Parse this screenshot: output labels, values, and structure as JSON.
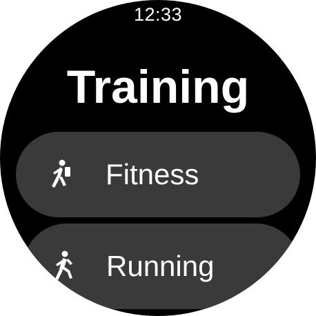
{
  "status_bar": {
    "time": "12:33"
  },
  "header": {
    "title": "Training"
  },
  "menu": {
    "items": [
      {
        "label": "Fitness",
        "icon": "fitness-walking-icon"
      },
      {
        "label": "Running",
        "icon": "running-icon"
      }
    ]
  },
  "colors": {
    "background": "#000000",
    "chip": "#3a3a3a",
    "text": "#ffffff"
  }
}
